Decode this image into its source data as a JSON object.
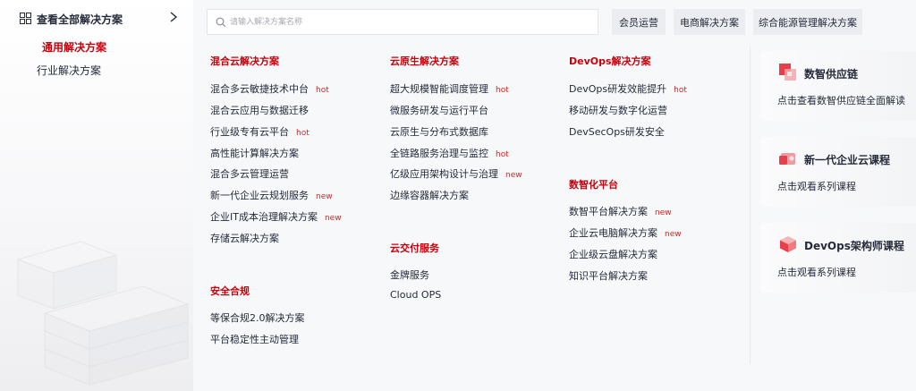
{
  "sidebar": {
    "title": "查看全部解决方案",
    "items": [
      {
        "label": "通用解决方案",
        "active": true
      },
      {
        "label": "行业解决方案",
        "active": false
      }
    ]
  },
  "search": {
    "placeholder": "请输入解决方案名称",
    "value": ""
  },
  "quick_tags": [
    "会员运营",
    "电商解决方案",
    "综合能源管理解决方案"
  ],
  "hybrid": {
    "title": "混合云解决方案",
    "items": [
      {
        "label": "混合多云敏捷技术中台",
        "tag": "hot"
      },
      {
        "label": "混合云应用与数据迁移",
        "tag": ""
      },
      {
        "label": "行业级专有云平台",
        "tag": "hot"
      },
      {
        "label": "高性能计算解决方案",
        "tag": ""
      },
      {
        "label": "混合多云管理运营",
        "tag": ""
      },
      {
        "label": "新一代企业云规划服务",
        "tag": "new"
      },
      {
        "label": "企业IT成本治理解决方案",
        "tag": "new"
      },
      {
        "label": "存储云解决方案",
        "tag": ""
      }
    ]
  },
  "security": {
    "title": "安全合规",
    "items": [
      {
        "label": "等保合规2.0解决方案",
        "tag": ""
      },
      {
        "label": "平台稳定性主动管理",
        "tag": ""
      }
    ]
  },
  "cloud_native": {
    "title": "云原生解决方案",
    "items": [
      {
        "label": "超大规模智能调度管理",
        "tag": "hot"
      },
      {
        "label": "微服务研发与运行平台",
        "tag": ""
      },
      {
        "label": "云原生与分布式数据库",
        "tag": ""
      },
      {
        "label": "全链路服务治理与监控",
        "tag": "hot"
      },
      {
        "label": "亿级应用架构设计与治理",
        "tag": "new"
      },
      {
        "label": "边缘容器解决方案",
        "tag": ""
      }
    ]
  },
  "delivery": {
    "title": "云交付服务",
    "items": [
      {
        "label": "金牌服务",
        "tag": ""
      },
      {
        "label": "Cloud OPS",
        "tag": ""
      }
    ]
  },
  "devops": {
    "title": "DevOps解决方案",
    "items": [
      {
        "label": "DevOps研发效能提升",
        "tag": "hot"
      },
      {
        "label": "移动研发与数字化运营",
        "tag": ""
      },
      {
        "label": "DevSecOps研发安全",
        "tag": ""
      }
    ]
  },
  "digital": {
    "title": "数智化平台",
    "items": [
      {
        "label": "数智平台解决方案",
        "tag": "new"
      },
      {
        "label": "企业云电脑解决方案",
        "tag": "new"
      },
      {
        "label": "企业级云盘解决方案",
        "tag": ""
      },
      {
        "label": "知识平台解决方案",
        "tag": ""
      }
    ]
  },
  "cards": [
    {
      "title": "数智供应链",
      "desc": "点击查看数智供应链全面解读",
      "icon": "supply-chain-icon"
    },
    {
      "title": "新一代企业云课程",
      "desc": "点击观看系列课程",
      "icon": "cloud-course-icon"
    },
    {
      "title": "DevOps架构师课程",
      "desc": "点击观看系列课程",
      "icon": "devops-course-icon"
    }
  ],
  "colors": {
    "accent": "#c7000b",
    "tag": "#e02020",
    "text": "#252b3a",
    "panel": "#f7f8fa",
    "chip": "#ebedf0"
  }
}
